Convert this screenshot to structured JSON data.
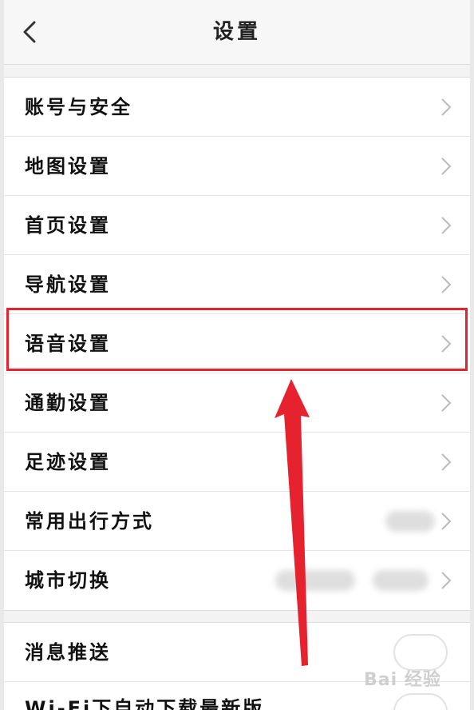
{
  "header": {
    "title": "设置"
  },
  "group1": {
    "items": [
      {
        "label": "账号与安全"
      },
      {
        "label": "地图设置"
      },
      {
        "label": "首页设置"
      },
      {
        "label": "导航设置"
      },
      {
        "label": "语音设置"
      },
      {
        "label": "通勤设置"
      },
      {
        "label": "足迹设置"
      },
      {
        "label": "常用出行方式"
      },
      {
        "label": "城市切换"
      }
    ]
  },
  "group2": {
    "items": [
      {
        "label": "消息推送"
      },
      {
        "label": "Wi-Fi下自动下载最新版"
      }
    ]
  },
  "annotation": {
    "highlight_color": "#e5222d"
  },
  "watermark": {
    "text": "Bai 经验"
  },
  "icons": [
    "chevron-left-icon",
    "chevron-right-icon",
    "toggle-switch",
    "arrow-annotation"
  ]
}
